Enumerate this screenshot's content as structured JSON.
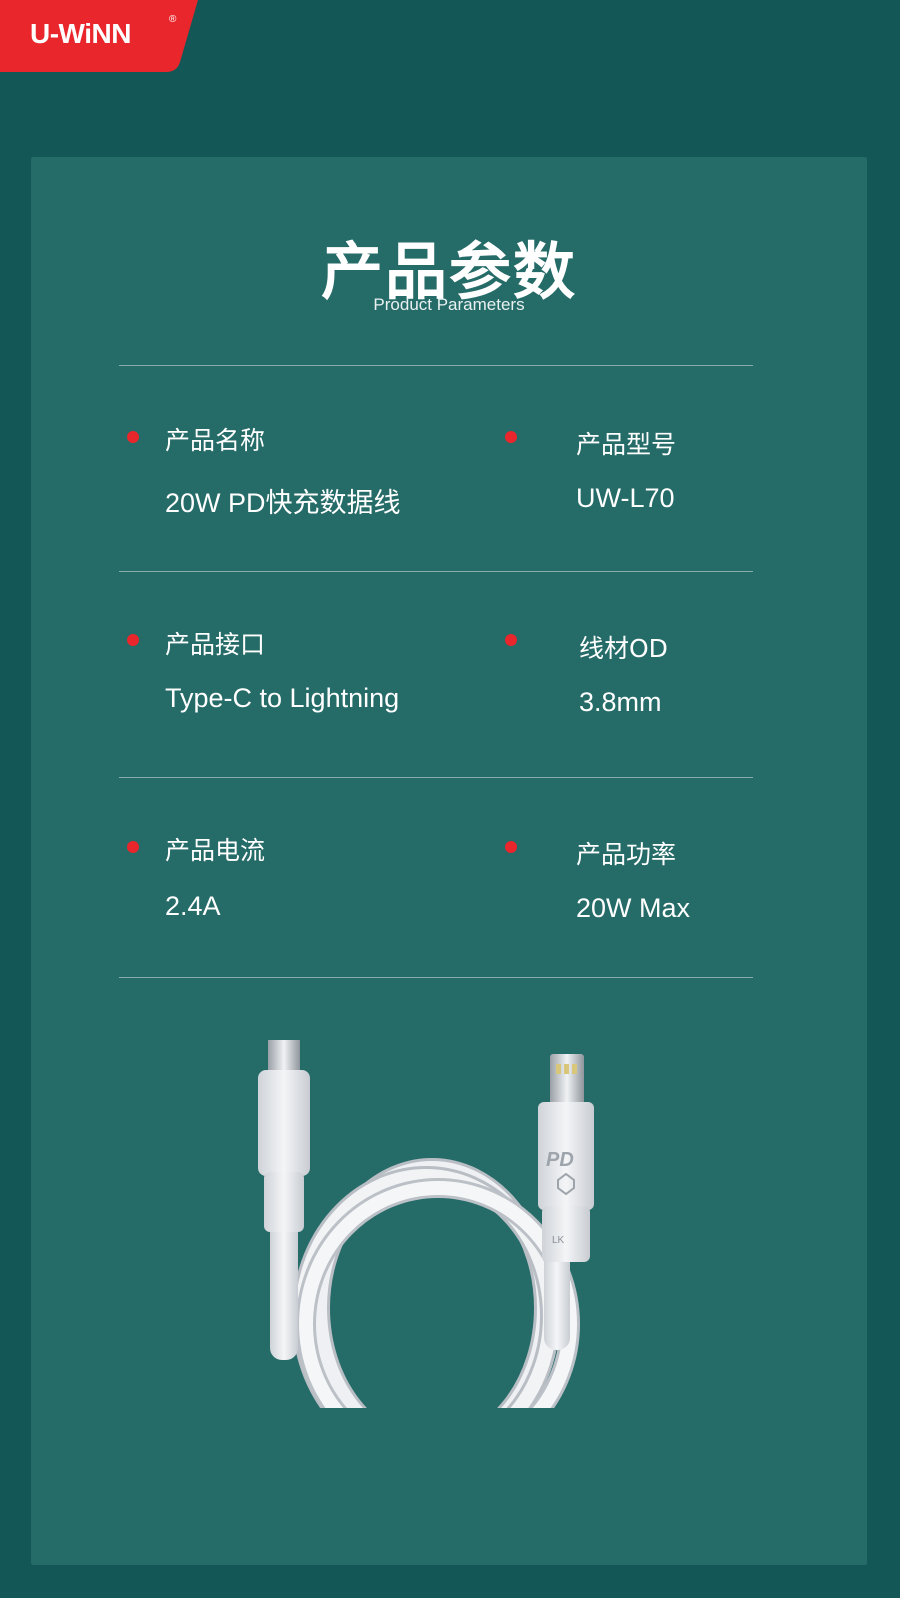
{
  "brand": {
    "logo_text": "U-WiNN",
    "registered_mark": "®",
    "badge_color": "#e8262b"
  },
  "header": {
    "title": "产品参数",
    "subtitle": "Product Parameters"
  },
  "params": [
    {
      "label": "产品名称",
      "value": "20W PD快充数据线"
    },
    {
      "label": "产品型号",
      "value": "UW-L70"
    },
    {
      "label": "产品接口",
      "value": "Type-C to Lightning"
    },
    {
      "label": "线材OD",
      "value": "3.8mm"
    },
    {
      "label": "产品电流",
      "value": "2.4A"
    },
    {
      "label": "产品功率",
      "value": "20W Max"
    }
  ],
  "product_image": {
    "plug_mark": "PD",
    "cable_mark": "LK"
  },
  "colors": {
    "background": "#135856",
    "card": "#256b68",
    "accent": "#e8262b"
  }
}
